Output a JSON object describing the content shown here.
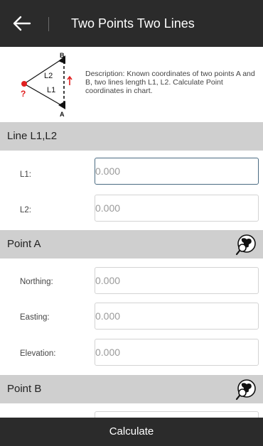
{
  "header": {
    "title": "Two Points Two Lines"
  },
  "description": {
    "text": "Description: Known coordinates of two points A and B, two lines length L1, L2. Calculate Point coordinates in chart.",
    "diagram_labels": {
      "point_b": "B",
      "point_a": "A",
      "line_2": "L2",
      "line_1": "L1",
      "unknown": "?"
    }
  },
  "sections": {
    "lines": {
      "title": "Line L1,L2",
      "l1": {
        "label": "L1:",
        "placeholder": "0.000"
      },
      "l2": {
        "label": "L2:",
        "placeholder": "0.000"
      }
    },
    "point_a": {
      "title": "Point A",
      "icon": "map-pick-icon",
      "northing": {
        "label": "Northing:",
        "placeholder": "0.000"
      },
      "easting": {
        "label": "Easting:",
        "placeholder": "0.000"
      },
      "elevation": {
        "label": "Elevation:",
        "placeholder": "0.000"
      }
    },
    "point_b": {
      "title": "Point B",
      "icon": "map-pick-icon"
    }
  },
  "footer": {
    "calculate_label": "Calculate"
  },
  "colors": {
    "topbar": "#2b2b2b",
    "section_header": "#cfcfcf",
    "focus_border": "#4a6b82",
    "point_red": "#e02020",
    "marker_black": "#111111"
  }
}
